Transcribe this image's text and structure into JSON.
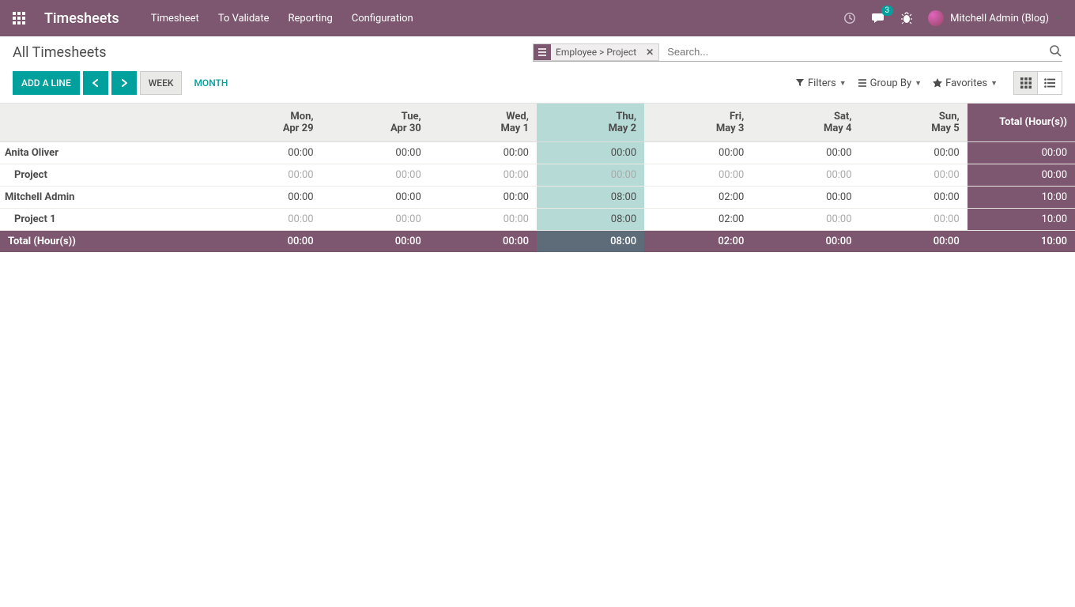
{
  "nav": {
    "brand": "Timesheets",
    "links": [
      "Timesheet",
      "To Validate",
      "Reporting",
      "Configuration"
    ],
    "conversation_count": "3",
    "user_label": "Mitchell Admin (Blog)"
  },
  "cp": {
    "title": "All Timesheets",
    "facet_label": "Employee > Project",
    "search_placeholder": "Search...",
    "add_line": "ADD A LINE",
    "scale_week": "WEEK",
    "scale_month": "MONTH",
    "filters_label": "Filters",
    "groupby_label": "Group By",
    "favorites_label": "Favorites"
  },
  "grid": {
    "total_header": "Total (Hour(s))",
    "footer_label": "Total (Hour(s))",
    "today_index": 3,
    "days": [
      {
        "name": "Mon,",
        "date": "Apr 29"
      },
      {
        "name": "Tue,",
        "date": "Apr 30"
      },
      {
        "name": "Wed,",
        "date": "May 1"
      },
      {
        "name": "Thu,",
        "date": "May 2"
      },
      {
        "name": "Fri,",
        "date": "May 3"
      },
      {
        "name": "Sat,",
        "date": "May 4"
      },
      {
        "name": "Sun,",
        "date": "May 5"
      }
    ],
    "groups": [
      {
        "label": "Anita Oliver",
        "values": [
          "00:00",
          "00:00",
          "00:00",
          "00:00",
          "00:00",
          "00:00",
          "00:00"
        ],
        "total": "00:00",
        "rows": [
          {
            "label": "Project",
            "values": [
              "00:00",
              "00:00",
              "00:00",
              "00:00",
              "00:00",
              "00:00",
              "00:00"
            ],
            "total": "00:00"
          }
        ]
      },
      {
        "label": "Mitchell Admin",
        "values": [
          "00:00",
          "00:00",
          "00:00",
          "08:00",
          "02:00",
          "00:00",
          "00:00"
        ],
        "total": "10:00",
        "rows": [
          {
            "label": "Project 1",
            "values": [
              "00:00",
              "00:00",
              "00:00",
              "08:00",
              "02:00",
              "00:00",
              "00:00"
            ],
            "total": "10:00"
          }
        ]
      }
    ],
    "footer": {
      "values": [
        "00:00",
        "00:00",
        "00:00",
        "08:00",
        "02:00",
        "00:00",
        "00:00"
      ],
      "total": "10:00"
    }
  }
}
